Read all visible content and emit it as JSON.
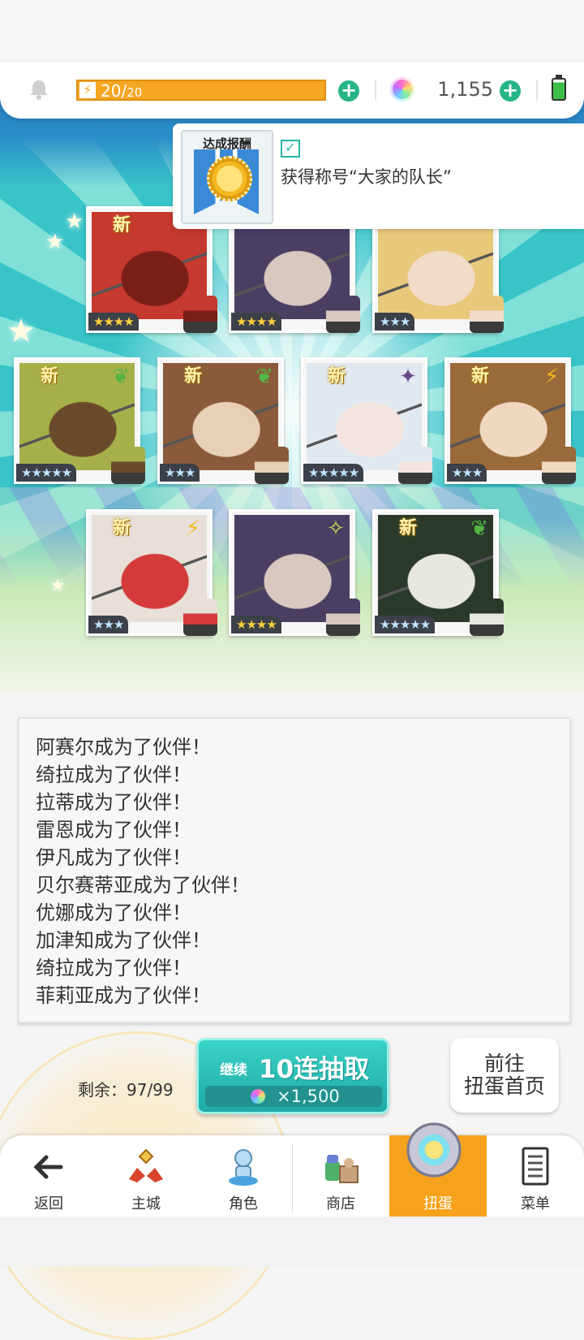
{
  "status": {
    "stamina_value": "20/",
    "stamina_max": "20",
    "gem_count": "1,155",
    "colors": {
      "stamina": "#f5a623",
      "plus": "#26b588"
    }
  },
  "achievement": {
    "badge_label": "达成报酬",
    "text": "获得称号“大家的队长”"
  },
  "cards": [
    {
      "name": "card-1",
      "new": "新",
      "stars": "★★★★",
      "star_style": "gold",
      "element": ""
    },
    {
      "name": "card-2",
      "new": "",
      "stars": "★★★★",
      "star_style": "gold",
      "element": ""
    },
    {
      "name": "card-3",
      "new": "",
      "stars": "★★★",
      "star_style": "blue",
      "element": ""
    },
    {
      "name": "card-4",
      "new": "新",
      "stars": "★★★★★",
      "star_style": "blue",
      "element": "leaf"
    },
    {
      "name": "card-5",
      "new": "新",
      "stars": "★★★",
      "star_style": "blue",
      "element": "leaf"
    },
    {
      "name": "card-6",
      "new": "新",
      "stars": "★★★★★",
      "star_style": "blue",
      "element": "dark"
    },
    {
      "name": "card-7",
      "new": "新",
      "stars": "★★★",
      "star_style": "blue",
      "element": "bolt"
    },
    {
      "name": "card-8",
      "new": "新",
      "stars": "★★★",
      "star_style": "blue",
      "element": "bolt"
    },
    {
      "name": "card-9",
      "new": "",
      "stars": "★★★★",
      "star_style": "gold",
      "element": "light"
    },
    {
      "name": "card-10",
      "new": "新",
      "stars": "★★★★★",
      "star_style": "blue",
      "element": "leaf"
    }
  ],
  "log": {
    "lines": [
      "阿赛尔成为了伙伴！",
      "绮拉成为了伙伴！",
      "拉蒂成为了伙伴！",
      "雷恩成为了伙伴！",
      "伊凡成为了伙伴！",
      "贝尔赛蒂亚成为了伙伴！",
      "优娜成为了伙伴！",
      "加津知成为了伙伴！",
      "绮拉成为了伙伴！",
      "菲莉亚成为了伙伴！"
    ]
  },
  "controls": {
    "remaining": "剩余：97/99",
    "continue_label": "继续",
    "pull_label": "10连抽取",
    "cost": "×1,500",
    "home_line1": "前往",
    "home_line2": "扭蛋首页"
  },
  "nav": {
    "items": [
      {
        "label": "返回",
        "icon": "back-arrow-icon"
      },
      {
        "label": "主城",
        "icon": "castle-icon"
      },
      {
        "label": "角色",
        "icon": "character-icon"
      },
      {
        "label": "商店",
        "icon": "shop-icon"
      },
      {
        "label": "扭蛋",
        "icon": "gacha-icon",
        "active": true
      },
      {
        "label": "菜单",
        "icon": "menu-icon"
      }
    ]
  }
}
